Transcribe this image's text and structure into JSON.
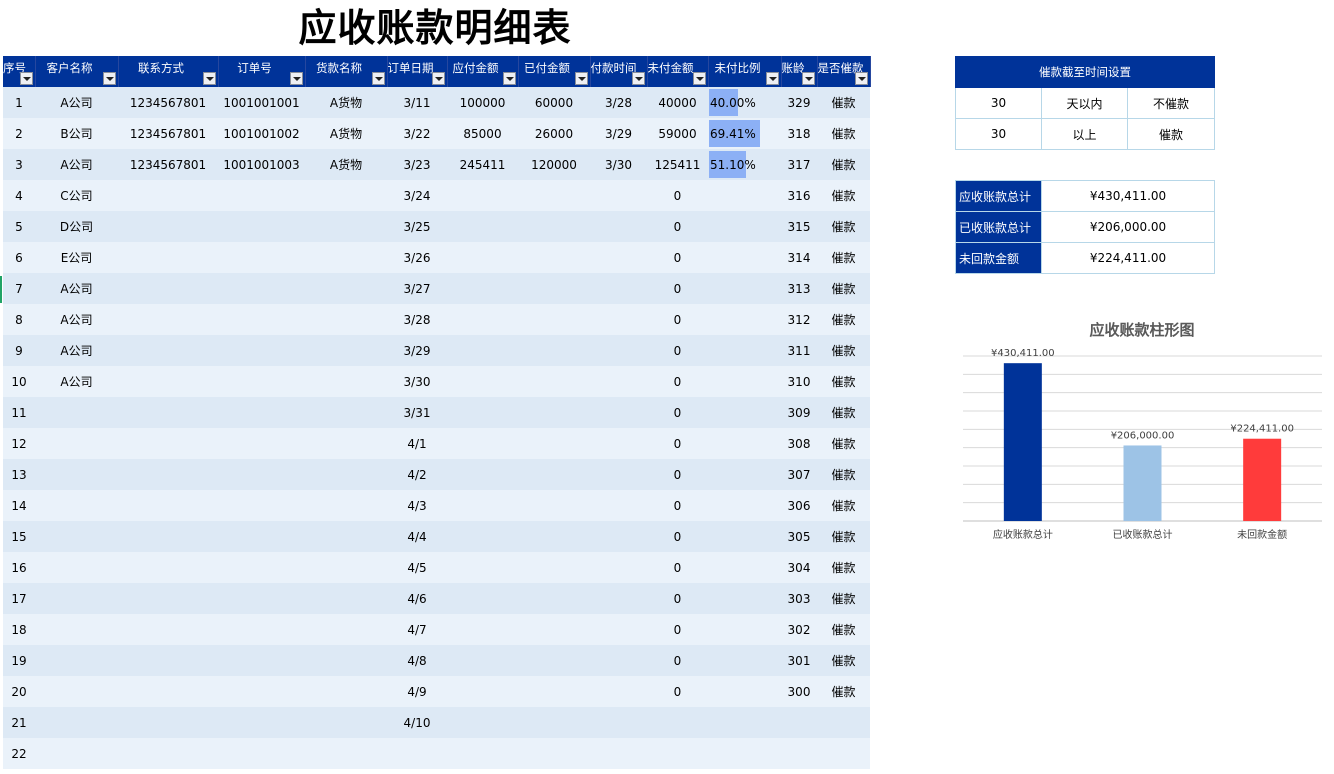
{
  "title": "应收账款明细表",
  "columns": [
    "序号",
    "客户名称",
    "联系方式",
    "订单号",
    "货款名称",
    "订单日期",
    "应付金额",
    "已付金额",
    "付款时间",
    "未付金额",
    "未付比例",
    "账龄",
    "是否催款"
  ],
  "rows": [
    {
      "seq": "1",
      "customer": "A公司",
      "contact": "1234567801",
      "order_no": "1001001001",
      "goods": "A货物",
      "order_date": "3/11",
      "payable": "100000",
      "paid": "60000",
      "pay_time": "3/28",
      "unpaid": "40000",
      "ratio_text": "40.00%",
      "ratio": 0.4,
      "age": "329",
      "dun": "催款"
    },
    {
      "seq": "2",
      "customer": "B公司",
      "contact": "1234567801",
      "order_no": "1001001002",
      "goods": "A货物",
      "order_date": "3/22",
      "payable": "85000",
      "paid": "26000",
      "pay_time": "3/29",
      "unpaid": "59000",
      "ratio_text": "69.41%",
      "ratio": 0.6941,
      "age": "318",
      "dun": "催款"
    },
    {
      "seq": "3",
      "customer": "A公司",
      "contact": "1234567801",
      "order_no": "1001001003",
      "goods": "A货物",
      "order_date": "3/23",
      "payable": "245411",
      "paid": "120000",
      "pay_time": "3/30",
      "unpaid": "125411",
      "ratio_text": "51.10%",
      "ratio": 0.511,
      "age": "317",
      "dun": "催款"
    },
    {
      "seq": "4",
      "customer": "C公司",
      "order_date": "3/24",
      "unpaid": "0",
      "age": "316",
      "dun": "催款"
    },
    {
      "seq": "5",
      "customer": "D公司",
      "order_date": "3/25",
      "unpaid": "0",
      "age": "315",
      "dun": "催款"
    },
    {
      "seq": "6",
      "customer": "E公司",
      "order_date": "3/26",
      "unpaid": "0",
      "age": "314",
      "dun": "催款"
    },
    {
      "seq": "7",
      "customer": "A公司",
      "order_date": "3/27",
      "unpaid": "0",
      "age": "313",
      "dun": "催款"
    },
    {
      "seq": "8",
      "customer": "A公司",
      "order_date": "3/28",
      "unpaid": "0",
      "age": "312",
      "dun": "催款"
    },
    {
      "seq": "9",
      "customer": "A公司",
      "order_date": "3/29",
      "unpaid": "0",
      "age": "311",
      "dun": "催款"
    },
    {
      "seq": "10",
      "customer": "A公司",
      "order_date": "3/30",
      "unpaid": "0",
      "age": "310",
      "dun": "催款"
    },
    {
      "seq": "11",
      "order_date": "3/31",
      "unpaid": "0",
      "age": "309",
      "dun": "催款"
    },
    {
      "seq": "12",
      "order_date": "4/1",
      "unpaid": "0",
      "age": "308",
      "dun": "催款"
    },
    {
      "seq": "13",
      "order_date": "4/2",
      "unpaid": "0",
      "age": "307",
      "dun": "催款"
    },
    {
      "seq": "14",
      "order_date": "4/3",
      "unpaid": "0",
      "age": "306",
      "dun": "催款"
    },
    {
      "seq": "15",
      "order_date": "4/4",
      "unpaid": "0",
      "age": "305",
      "dun": "催款"
    },
    {
      "seq": "16",
      "order_date": "4/5",
      "unpaid": "0",
      "age": "304",
      "dun": "催款"
    },
    {
      "seq": "17",
      "order_date": "4/6",
      "unpaid": "0",
      "age": "303",
      "dun": "催款"
    },
    {
      "seq": "18",
      "order_date": "4/7",
      "unpaid": "0",
      "age": "302",
      "dun": "催款"
    },
    {
      "seq": "19",
      "order_date": "4/8",
      "unpaid": "0",
      "age": "301",
      "dun": "催款"
    },
    {
      "seq": "20",
      "order_date": "4/9",
      "unpaid": "0",
      "age": "300",
      "dun": "催款"
    },
    {
      "seq": "21",
      "order_date": "4/10"
    },
    {
      "seq": "22"
    }
  ],
  "dun_settings": {
    "header": "催款截至时间设置",
    "rows": [
      [
        "30",
        "天以内",
        "不催款"
      ],
      [
        "30",
        "以上",
        "催款"
      ]
    ]
  },
  "summary": [
    {
      "label": "应收账款总计",
      "value": "¥430,411.00"
    },
    {
      "label": "已收账款总计",
      "value": "¥206,000.00"
    },
    {
      "label": "未回款金额",
      "value": "¥224,411.00"
    }
  ],
  "chart_data": {
    "type": "bar",
    "title": "应收账款柱形图",
    "categories": [
      "应收账款总计",
      "已收账款总计",
      "未回款金额"
    ],
    "values": [
      430411,
      206000,
      224411
    ],
    "data_labels": [
      "¥430,411.00",
      "¥206,000.00",
      "¥224,411.00"
    ],
    "colors": [
      "#003399",
      "#9dc3e6",
      "#ff3b3b"
    ],
    "ylim": [
      0,
      450000
    ],
    "grid": true,
    "legend": "none"
  },
  "colors": {
    "header": "#003399",
    "row_odd": "#dde9f5",
    "row_even": "#eaf2fa",
    "ratio_bar": "#8cb0f5"
  }
}
